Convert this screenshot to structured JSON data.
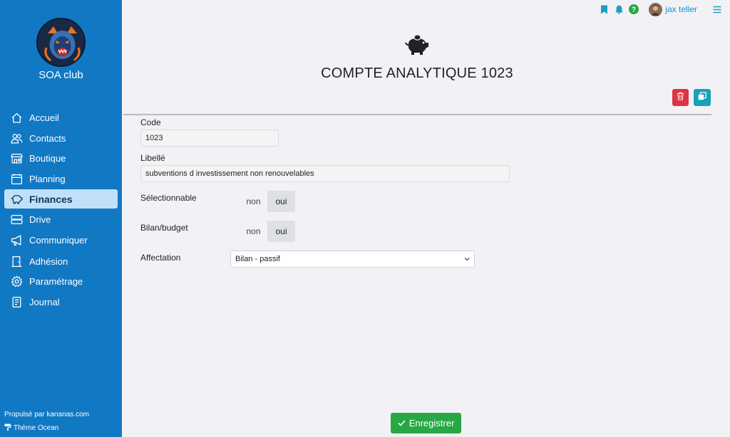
{
  "sidebar": {
    "club_name": "SOA club",
    "items": [
      {
        "label": "Accueil",
        "icon": "home-icon"
      },
      {
        "label": "Contacts",
        "icon": "people-icon"
      },
      {
        "label": "Boutique",
        "icon": "shop-icon"
      },
      {
        "label": "Planning",
        "icon": "calendar-icon"
      },
      {
        "label": "Finances",
        "icon": "piggy-bank-icon",
        "active": true
      },
      {
        "label": "Drive",
        "icon": "drive-icon"
      },
      {
        "label": "Communiquer",
        "icon": "megaphone-icon"
      },
      {
        "label": "Adhésion",
        "icon": "door-icon"
      },
      {
        "label": "Paramétrage",
        "icon": "gear-icon"
      },
      {
        "label": "Journal",
        "icon": "journal-icon"
      }
    ],
    "footer_powered": "Propulsé par kananas.com",
    "footer_theme": "Thème Ocean"
  },
  "topbar": {
    "user_name": "jax teller",
    "icons": [
      "bookmark-icon",
      "bell-icon",
      "help-icon",
      "menu-icon"
    ]
  },
  "main": {
    "title": "COMPTE ANALYTIQUE 1023",
    "fields": {
      "code_label": "Code",
      "code_value": "1023",
      "libelle_label": "Libellé",
      "libelle_value": "subventions d investissement non renouvelables",
      "selectionnable_label": "Sélectionnable",
      "bilan_label": "Bilan/budget",
      "affectation_label": "Affectation",
      "affectation_value": "Bilan - passif"
    },
    "toggle_non": "non",
    "toggle_oui": "oui",
    "selectionnable_value": "oui",
    "bilan_value": "oui",
    "save_label": "Enregistrer"
  },
  "colors": {
    "sidebar": "#1178c4",
    "active_item": "#bfe0f8",
    "delete": "#dc3545",
    "duplicate": "#17a2b8",
    "save": "#28a745"
  }
}
